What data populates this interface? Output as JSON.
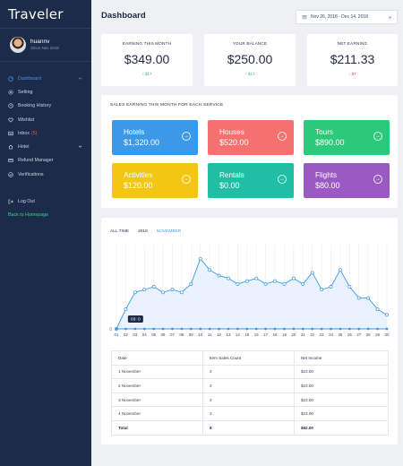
{
  "app": {
    "name": "Traveler"
  },
  "user": {
    "name": "huannv",
    "since": "Since Nov 2018"
  },
  "nav": [
    {
      "id": "dashboard",
      "label": "Dashboard",
      "icon": "dashboard-icon",
      "active": true,
      "chevron": true
    },
    {
      "id": "setting",
      "label": "Setting",
      "icon": "gear-icon"
    },
    {
      "id": "booking-history",
      "label": "Booking History",
      "icon": "clock-icon"
    },
    {
      "id": "wishlist",
      "label": "Wishlist",
      "icon": "heart-icon"
    },
    {
      "id": "inbox",
      "label": "Inbox",
      "icon": "inbox-icon",
      "badge": "(5)"
    },
    {
      "id": "hotel",
      "label": "Hotel",
      "icon": "home-icon",
      "chevron": true
    },
    {
      "id": "refund-manager",
      "label": "Refund Manager",
      "icon": "refund-icon"
    },
    {
      "id": "verifications",
      "label": "Verifications",
      "icon": "check-circle-icon"
    }
  ],
  "nav_bottom": [
    {
      "id": "log-out",
      "label": "Log Out",
      "icon": "logout-icon"
    },
    {
      "id": "back-home",
      "label": "Back to Homepage"
    }
  ],
  "header": {
    "title": "Dashboard",
    "date_range": "Nov 26, 2018 - Dec 14, 2018"
  },
  "stats": [
    {
      "label": "EARNING THIS MONTH",
      "value": "$349.00",
      "change": "↑ $17",
      "trend": "up"
    },
    {
      "label": "YOUR BALANCE",
      "value": "$250.00",
      "change": "↑ $17",
      "trend": "up"
    },
    {
      "label": "NET EARNING",
      "value": "$211.33",
      "change": "↓ $7",
      "trend": "down"
    }
  ],
  "services": {
    "title": "SALES EARNING THIS MONTH FOR EACH SERVICE",
    "items": [
      {
        "name": "Hotels",
        "amount": "$1,320.00",
        "color": "#3b99e8"
      },
      {
        "name": "Houses",
        "amount": "$520.00",
        "color": "#f4716f"
      },
      {
        "name": "Tours",
        "amount": "$890.00",
        "color": "#2dc97b"
      },
      {
        "name": "Activities",
        "amount": "$120.00",
        "color": "#f3c613"
      },
      {
        "name": "Rentals",
        "amount": "$0.00",
        "color": "#1fbea5"
      },
      {
        "name": "Flights",
        "amount": "$80.00",
        "color": "#9b59c4"
      }
    ]
  },
  "filters": [
    {
      "label": "ALL TIME",
      "selected": false
    },
    {
      "label": "2018",
      "selected": false
    },
    {
      "label": "NOVEMBER",
      "selected": true
    }
  ],
  "chart_data": {
    "type": "area",
    "x": [
      "01",
      "02",
      "03",
      "04",
      "05",
      "06",
      "07",
      "08",
      "09",
      "10",
      "11",
      "12",
      "13",
      "14",
      "15",
      "16",
      "17",
      "18",
      "19",
      "20",
      "21",
      "22",
      "23",
      "24",
      "25",
      "26",
      "27",
      "28",
      "29",
      "30"
    ],
    "series": [
      {
        "values": [
          0,
          7,
          13,
          14,
          15,
          13,
          14,
          13,
          16,
          25,
          21,
          19,
          18,
          16,
          17,
          18,
          16,
          17,
          16,
          18,
          16,
          20,
          14,
          15,
          21,
          15,
          11,
          11,
          7,
          5
        ]
      },
      {
        "values": [
          0,
          0,
          0,
          0,
          0,
          0,
          0,
          0,
          0,
          0,
          0,
          0,
          0,
          0,
          0,
          0,
          0,
          0,
          0,
          0,
          0,
          0,
          0,
          0,
          0,
          0,
          0,
          0,
          0,
          0
        ]
      }
    ],
    "ylim": [
      0,
      30
    ],
    "y_ticks": [
      "0"
    ],
    "tooltip": "03: 0",
    "grid": true,
    "colors": {
      "line": "#3b99e8",
      "area": "#eaf3fd",
      "baseline": "#3b99e8"
    }
  },
  "table": {
    "columns": [
      "Date",
      "Item Sales Count",
      "Net Income"
    ],
    "rows": [
      [
        "1 November",
        "2",
        "$23.00"
      ],
      [
        "2 November",
        "2",
        "$23.00"
      ],
      [
        "3 November",
        "2",
        "$23.00"
      ],
      [
        "4 November",
        "2",
        "$23.00"
      ]
    ],
    "total": [
      "Total",
      "8",
      "$92.00"
    ]
  }
}
